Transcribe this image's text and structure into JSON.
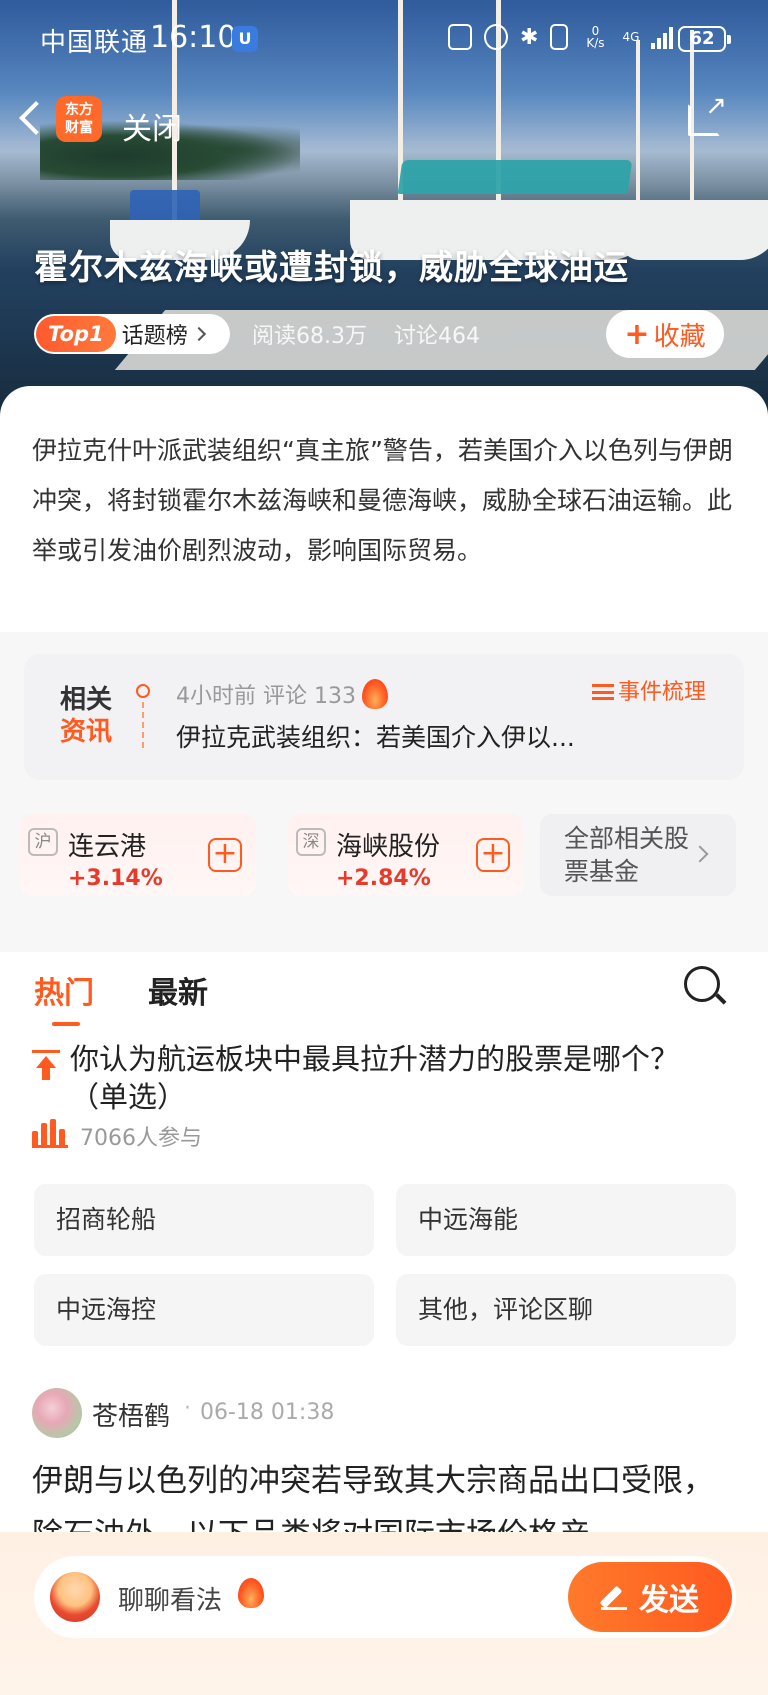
{
  "status_bar": {
    "carrier": "中国联通",
    "time": "16:10",
    "vpn_badge": "U",
    "net_speed_value": "0",
    "net_speed_unit": "K/s",
    "network": "4G",
    "battery": "62"
  },
  "nav": {
    "logo_text_line1": "东方",
    "logo_text_line2": "财富",
    "close_label": "关闭"
  },
  "hero": {
    "title": "霍尔木兹海峡或遭封锁，威胁全球油运",
    "rank_badge": "Top1",
    "topic_list_label": "话题榜",
    "reads": "阅读68.3万",
    "discussions": "讨论464",
    "favorite_label": "收藏"
  },
  "summary": {
    "text": "伊拉克什叶派武装组织“真主旅”警告，若美国介入以色列与伊朗冲突，将封锁霍尔木兹海峡和曼德海峡，威胁全球石油运输。此举或引发油价剧烈波动，影响国际贸易。"
  },
  "related_news": {
    "tag_line1": "相关",
    "tag_line2": "资讯",
    "meta": "4小时前 评论 133",
    "title": "伊拉克武装组织：若美国介入伊以...",
    "event_link": "事件梳理"
  },
  "stocks": [
    {
      "market": "沪",
      "name": "连云港",
      "change": "+3.14%"
    },
    {
      "market": "深",
      "name": "海峡股份",
      "change": "+2.84%"
    }
  ],
  "all_stocks_label": "全部相关股票基金",
  "tabs": {
    "hot": "热门",
    "latest": "最新"
  },
  "poll": {
    "question": "你认为航运板块中最具拉升潜力的股票是哪个？ （单选）",
    "participants": "7066人参与",
    "options": [
      "招商轮船",
      "中远海能",
      "中远海控",
      "其他，评论区聊"
    ]
  },
  "comment": {
    "user": "苍梧鹤",
    "separator": "·",
    "time": "06-18 01:38",
    "body": "伊朗与以色列的冲突若导致其大宗商品出口受限，除石油外，以下品类将对国际市场价格产"
  },
  "bottom_bar": {
    "placeholder": "聊聊看法",
    "send_label": "发送"
  },
  "colors": {
    "accent": "#ff5a1f",
    "rise": "#e83a2b"
  }
}
